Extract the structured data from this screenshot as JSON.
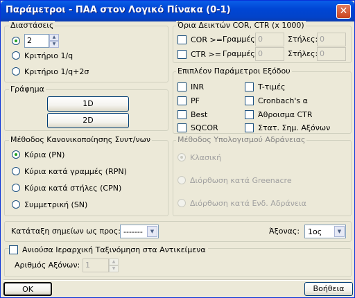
{
  "window": {
    "title": "Παράμετροι - ΠΑΑ στον Λογικό Πίνακα (0-1)",
    "close_label": "✕"
  },
  "dimensions": {
    "legend": "Διαστάσεις",
    "count_value": "2",
    "options": [
      "Κριτήριο 1/q",
      "Κριτήριο 1/q+2σ"
    ]
  },
  "graph": {
    "legend": "Γράφημα",
    "btn_1d": "1D",
    "btn_2d": "2D"
  },
  "normalization": {
    "legend": "Μέθοδος Κανονικοποίησης Συντ/νων",
    "options": [
      "Κύρια (PN)",
      "Κύρια κατά γραμμές (RPN)",
      "Κύρια κατά στήλες (CPN)",
      "Συμμετρική (SN)"
    ]
  },
  "cor_ctr": {
    "legend": "Όρια Δεικτών COR, CTR (x 1000)",
    "cor_label": "COR >=",
    "ctr_label": "CTR >=",
    "rows_label": "Γραμμές:",
    "cols_label": "Στήλες:",
    "cor_rows": "0",
    "cor_cols": "0",
    "ctr_rows": "0",
    "ctr_cols": "0"
  },
  "extra_output": {
    "legend": "Επιπλέον Παράμετροι Εξόδου",
    "left": [
      "INR",
      "PF",
      "Best",
      "SQCOR"
    ],
    "right": [
      "T-τιμές",
      "Cronbach's α",
      "Άθροισμα CTR",
      "Στατ. Σημ. Αξόνων"
    ]
  },
  "inertia": {
    "legend": "Μέθοδος Υπολογισμού Αδράνειας",
    "options": [
      "Κλασική",
      "Διόρθωση κατά Greenacre",
      "Διόρθωση κατά Ενδ. Αδράνεια"
    ]
  },
  "sort": {
    "label": "Κατάταξη σημείων ως προς:",
    "value": "-------",
    "axis_label": "Άξονας:",
    "axis_value": "1ος"
  },
  "clustering": {
    "label": "Ανιούσα Ιεραρχική Ταξινόμηση στα Αντικείμενα",
    "axes_label": "Αριθμός Αξόνων:",
    "axes_value": "1"
  },
  "footer": {
    "ok": "OK",
    "help": "Βοήθεια"
  }
}
